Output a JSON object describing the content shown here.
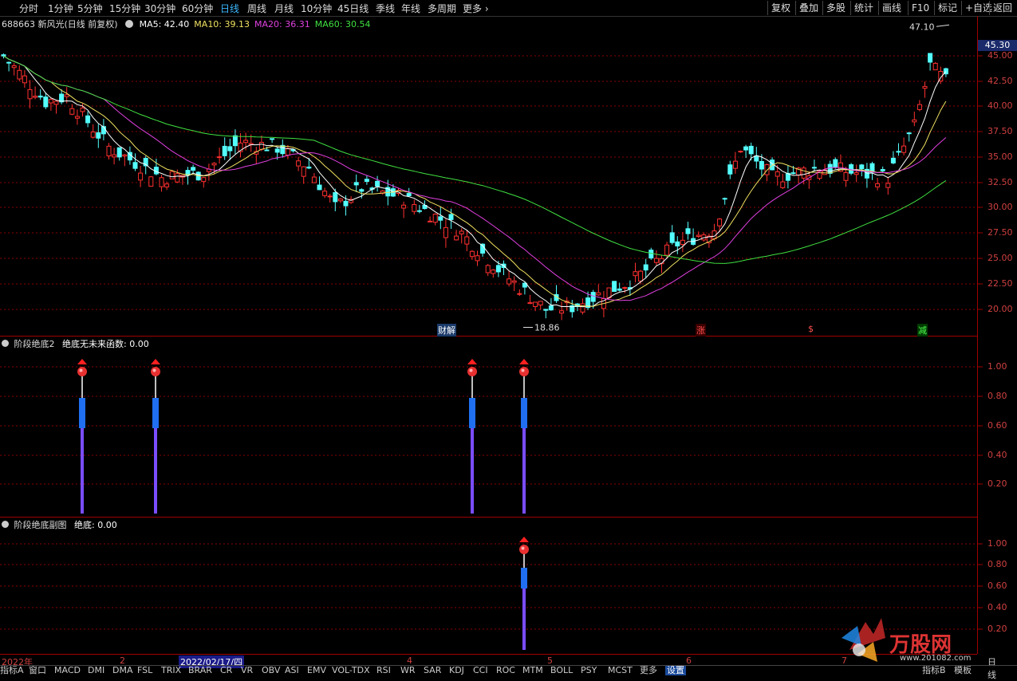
{
  "toolbar": {
    "periods": [
      "分时",
      "1分钟",
      "5分钟",
      "15分钟",
      "30分钟",
      "60分钟",
      "日线",
      "周线",
      "月线",
      "10分钟",
      "45日线",
      "季线",
      "年线",
      "多周期",
      "更多 ›"
    ],
    "active_period": "日线",
    "right_buttons": [
      "复权",
      "叠加",
      "多股",
      "统计",
      "画线",
      "F10",
      "标记",
      "+自选",
      "返回"
    ]
  },
  "main_panel": {
    "title": "688663 新风光(日线 前复权)",
    "ma": [
      {
        "label": "MA5: 42.40",
        "color": "#ffffff"
      },
      {
        "label": "MA10: 39.13",
        "color": "#f0e060"
      },
      {
        "label": "MA20: 36.31",
        "color": "#e040e0"
      },
      {
        "label": "MA60: 30.54",
        "color": "#40e040"
      }
    ],
    "last_price": "45.30",
    "high_label": "47.10",
    "low_label": "18.86",
    "y_ticks": [
      "45.00",
      "42.50",
      "40.00",
      "37.50",
      "35.00",
      "32.50",
      "30.00",
      "27.50",
      "25.00",
      "22.50",
      "20.00"
    ],
    "events": [
      {
        "label": "财解",
        "color": "#ffffff",
        "bg": "#1a3a6a"
      },
      {
        "label": "涨",
        "color": "#ff5050",
        "bg": "#3a0000"
      },
      {
        "label": "$",
        "color": "#ff5050",
        "bg": "#000000"
      },
      {
        "label": "减",
        "color": "#50ff50",
        "bg": "#003a00"
      }
    ]
  },
  "sub_panel_1": {
    "title": "阶段绝底2",
    "value_label": "绝底无未来函数: 0.00",
    "y_ticks": [
      "1.00",
      "0.80",
      "0.60",
      "0.40",
      "0.20"
    ]
  },
  "sub_panel_2": {
    "title": "阶段绝底副图",
    "value_label": "绝底: 0.00",
    "y_ticks": [
      "1.00",
      "0.80",
      "0.60",
      "0.40",
      "0.20"
    ]
  },
  "date_axis": {
    "labels": [
      "2022年",
      "2",
      "2022/02/17/四",
      "4",
      "5",
      "6",
      "7"
    ],
    "right_label": "日线"
  },
  "bottom_tabs": [
    "指标A",
    "窗口",
    "MACD",
    "DMI",
    "DMA",
    "FSL",
    "TRIX",
    "BRAR",
    "CR",
    "VR",
    "OBV",
    "ASI",
    "EMV",
    "VOL-TDX",
    "RSI",
    "WR",
    "SAR",
    "KDJ",
    "CCI",
    "ROC",
    "MTM",
    "BOLL",
    "PSY",
    "MCST",
    "更多",
    "设置"
  ],
  "bottom_right_tabs": [
    "指标B",
    "模板"
  ],
  "watermark": {
    "text": "万股网",
    "url": "www.201082.com"
  },
  "colors": {
    "up": "#ff3030",
    "down": "#54ffff",
    "grid": "#8a0000",
    "axis_text": "#d04040"
  }
}
